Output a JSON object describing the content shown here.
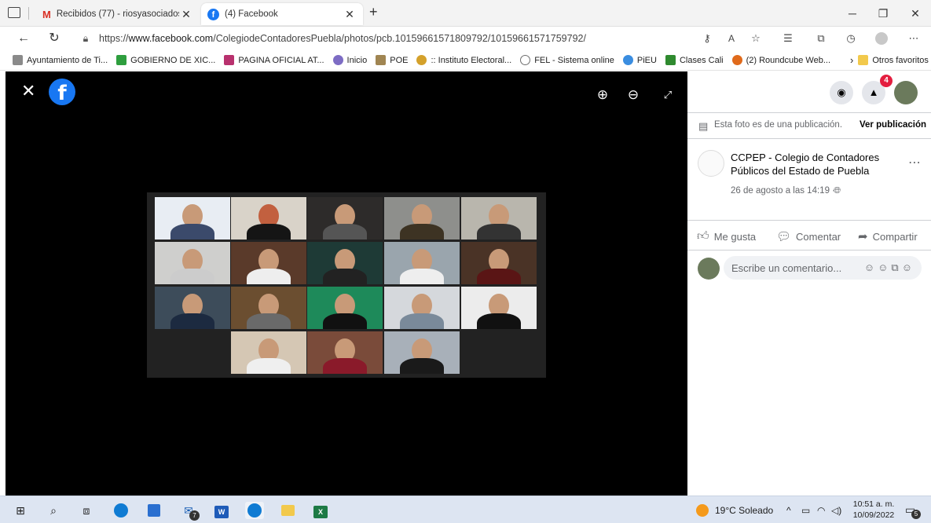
{
  "tabs": [
    {
      "title": "Recibidos (77) - riosyasociadosa",
      "icon": "gmail-icon"
    },
    {
      "title": "(4) Facebook",
      "icon": "facebook-icon"
    }
  ],
  "new_tab_label": "+",
  "address": {
    "scheme": "https://",
    "host": "www.facebook.com",
    "path": "/ColegiodeContadoresPuebla/photos/pcb.10159661571809792/10159661571759792/"
  },
  "bookmarks": [
    {
      "label": "Ayuntamiento de Ti...",
      "color": "#8a8a8a"
    },
    {
      "label": "GOBIERNO DE XIC...",
      "color": "#2e9e3e"
    },
    {
      "label": "PAGINA OFICIAL AT...",
      "color": "#b8316e"
    },
    {
      "label": "Inicio",
      "color": "#7d6cc4"
    },
    {
      "label": "POE",
      "color": "#a08552"
    },
    {
      "label": ":: Instituto Electoral...",
      "color": "#d4a12b"
    },
    {
      "label": "FEL - Sistema online",
      "color": "#6e6e6e"
    },
    {
      "label": "PiEU",
      "color": "#3a8de0"
    },
    {
      "label": "Clases Cali",
      "color": "#2f8a2f"
    },
    {
      "label": "(2) Roundcube Web...",
      "color": "#e06a1b"
    }
  ],
  "bookmarks_more": "Otros favoritos",
  "panel": {
    "notice": "Esta foto es de una publicación.",
    "view_post": "Ver publicación",
    "page_name": "CCPEP - Colegio de Contadores Públicos del Estado de Puebla",
    "post_date": "26 de agosto a las 14:19 ·",
    "like": "Me gusta",
    "comment": "Comentar",
    "share": "Compartir",
    "comment_placeholder": "Escribe un comentario...",
    "notification_count": "4"
  },
  "taskbar": {
    "weather": "19°C Soleado",
    "time": "10:51 a. m.",
    "date": "10/09/2022",
    "notification_count": "5",
    "mail_count": "7"
  },
  "colors": {
    "facebook_blue": "#1877f2",
    "badge_red": "#e41e3f",
    "viewer_bg": "#000000"
  }
}
